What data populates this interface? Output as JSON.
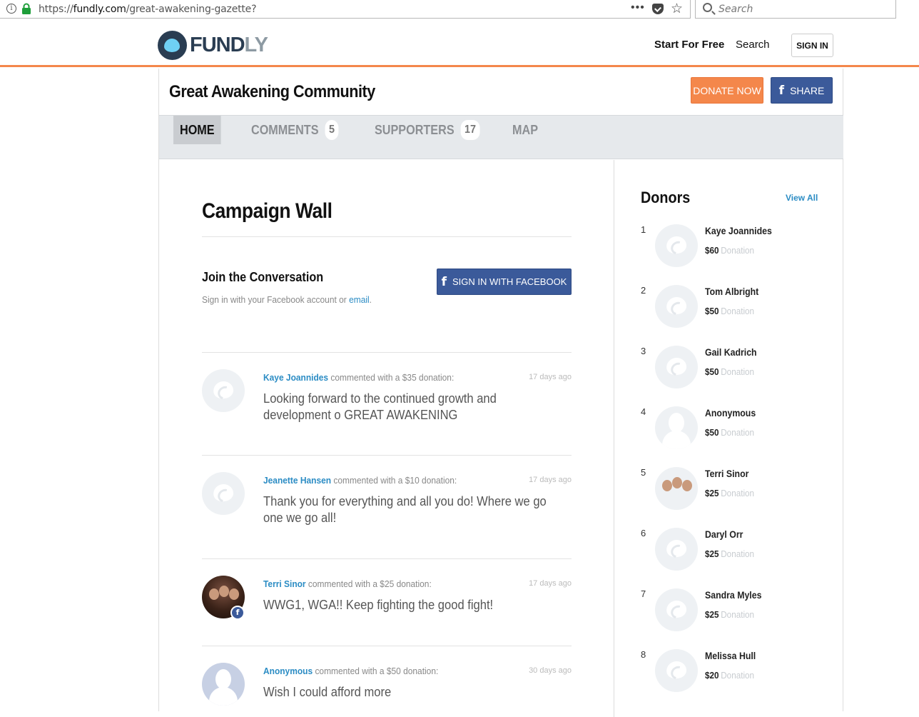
{
  "browser": {
    "url_prefix": "https://",
    "url_host": "fundly.com",
    "url_path": "/great-awakening-gazette?",
    "search_placeholder": "Search"
  },
  "header": {
    "logo_main": "FUND",
    "logo_accent": "LY",
    "nav_start": "Start For Free",
    "nav_search": "Search",
    "sign_in": "SIGN IN"
  },
  "campaign": {
    "title": "Great Awakening Community",
    "donate_label": "DONATE NOW",
    "share_label": "SHARE"
  },
  "tabs": [
    {
      "label": "HOME",
      "count": ""
    },
    {
      "label": "COMMENTS",
      "count": "5"
    },
    {
      "label": "SUPPORTERS",
      "count": "17"
    },
    {
      "label": "MAP",
      "count": ""
    }
  ],
  "wall": {
    "title": "Campaign Wall",
    "join_title": "Join the Conversation",
    "join_sub": "Sign in with your Facebook account or ",
    "join_link": "email",
    "join_end": ".",
    "fb_button": "SIGN IN WITH FACEBOOK"
  },
  "comments": [
    {
      "name": "Kaye Joannides",
      "action": " commented with a $35 donation:",
      "time": "17 days ago",
      "text": "Looking forward to the continued growth and development o GREAT AWAKENING"
    },
    {
      "name": "Jeanette Hansen",
      "action": " commented with a $10 donation:",
      "time": "17 days ago",
      "text": "Thank you for everything and all you do! Where we go one we go all!"
    },
    {
      "name": "Terri Sinor",
      "action": " commented with a $25 donation:",
      "time": "17 days ago",
      "text": "WWG1, WGA!! Keep fighting the good fight!"
    },
    {
      "name": "Anonymous",
      "action": " commented with a $50 donation:",
      "time": "30 days ago",
      "text": "Wish I could afford more"
    }
  ],
  "donors": {
    "title": "Donors",
    "view_all": "View All",
    "donation_label": "Donation",
    "list": [
      {
        "rank": "1",
        "name": "Kaye Joannides",
        "amount": "$60"
      },
      {
        "rank": "2",
        "name": "Tom Albright",
        "amount": "$50"
      },
      {
        "rank": "3",
        "name": "Gail Kadrich",
        "amount": "$50"
      },
      {
        "rank": "4",
        "name": "Anonymous",
        "amount": "$50"
      },
      {
        "rank": "5",
        "name": "Terri Sinor",
        "amount": "$25"
      },
      {
        "rank": "6",
        "name": "Daryl Orr",
        "amount": "$25"
      },
      {
        "rank": "7",
        "name": "Sandra Myles",
        "amount": "$25"
      },
      {
        "rank": "8",
        "name": "Melissa Hull",
        "amount": "$20"
      }
    ]
  },
  "colors": {
    "accent_orange": "#f4874b",
    "facebook_blue": "#3b5a9a",
    "link_blue": "#2b8cc4"
  }
}
